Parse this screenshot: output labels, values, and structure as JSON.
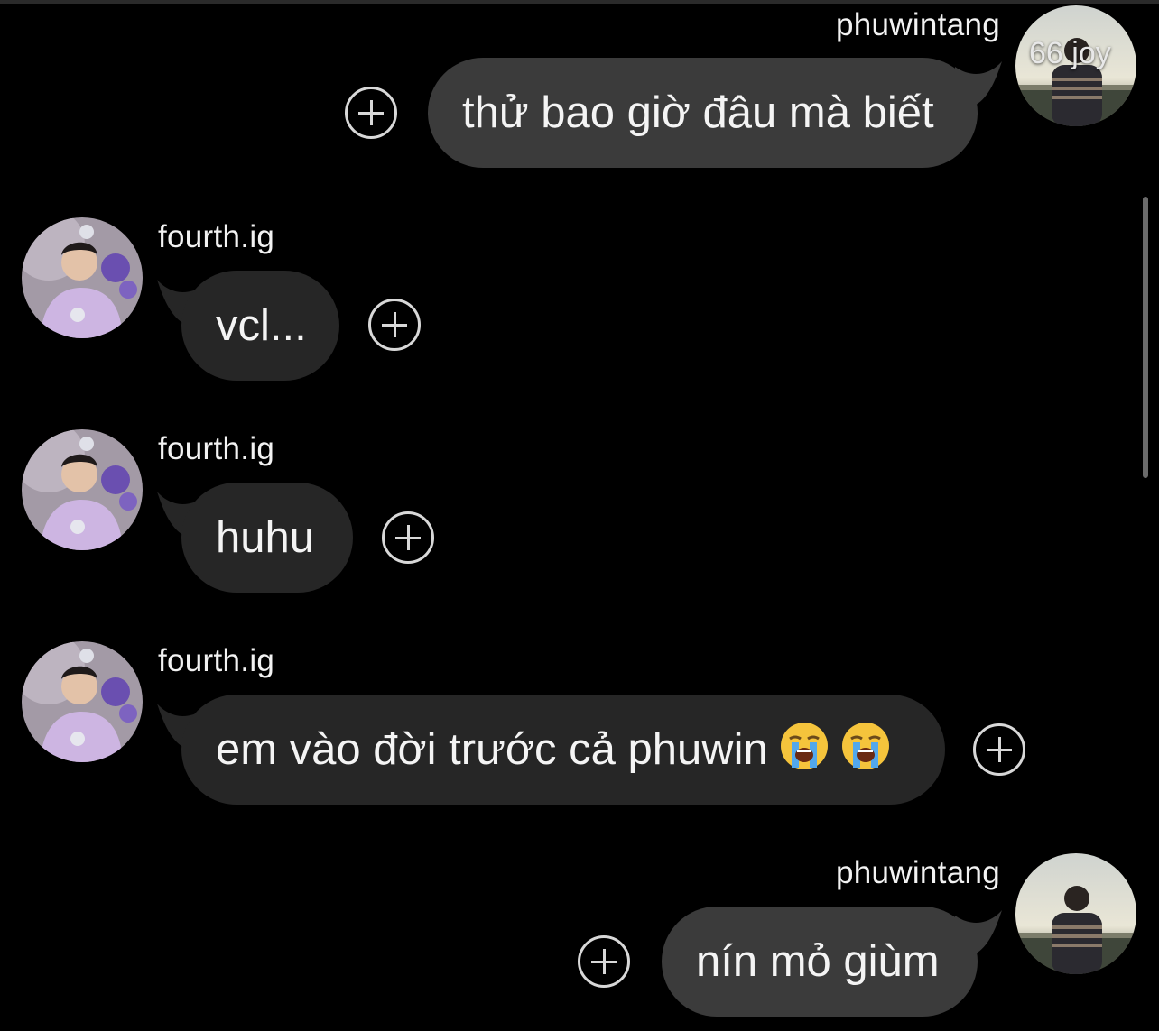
{
  "messages": [
    {
      "sender": "phuwintang",
      "text": "thử bao giờ đâu mà biết",
      "side": "right",
      "note": "66 joy"
    },
    {
      "sender": "fourth.ig",
      "text": "vcl...",
      "side": "left"
    },
    {
      "sender": "fourth.ig",
      "text": "huhu",
      "side": "left"
    },
    {
      "sender": "fourth.ig",
      "text": "em vào đời trước cả phuwin",
      "side": "left",
      "emojis": [
        "loudly-crying-face-icon",
        "loudly-crying-face-icon"
      ]
    },
    {
      "sender": "phuwintang",
      "text": "nín mỏ giùm",
      "side": "right"
    }
  ],
  "colors": {
    "background": "#000000",
    "bubble_mine": "#3b3b3b",
    "bubble_theirs": "#262626",
    "text": "#f4f4f4"
  }
}
